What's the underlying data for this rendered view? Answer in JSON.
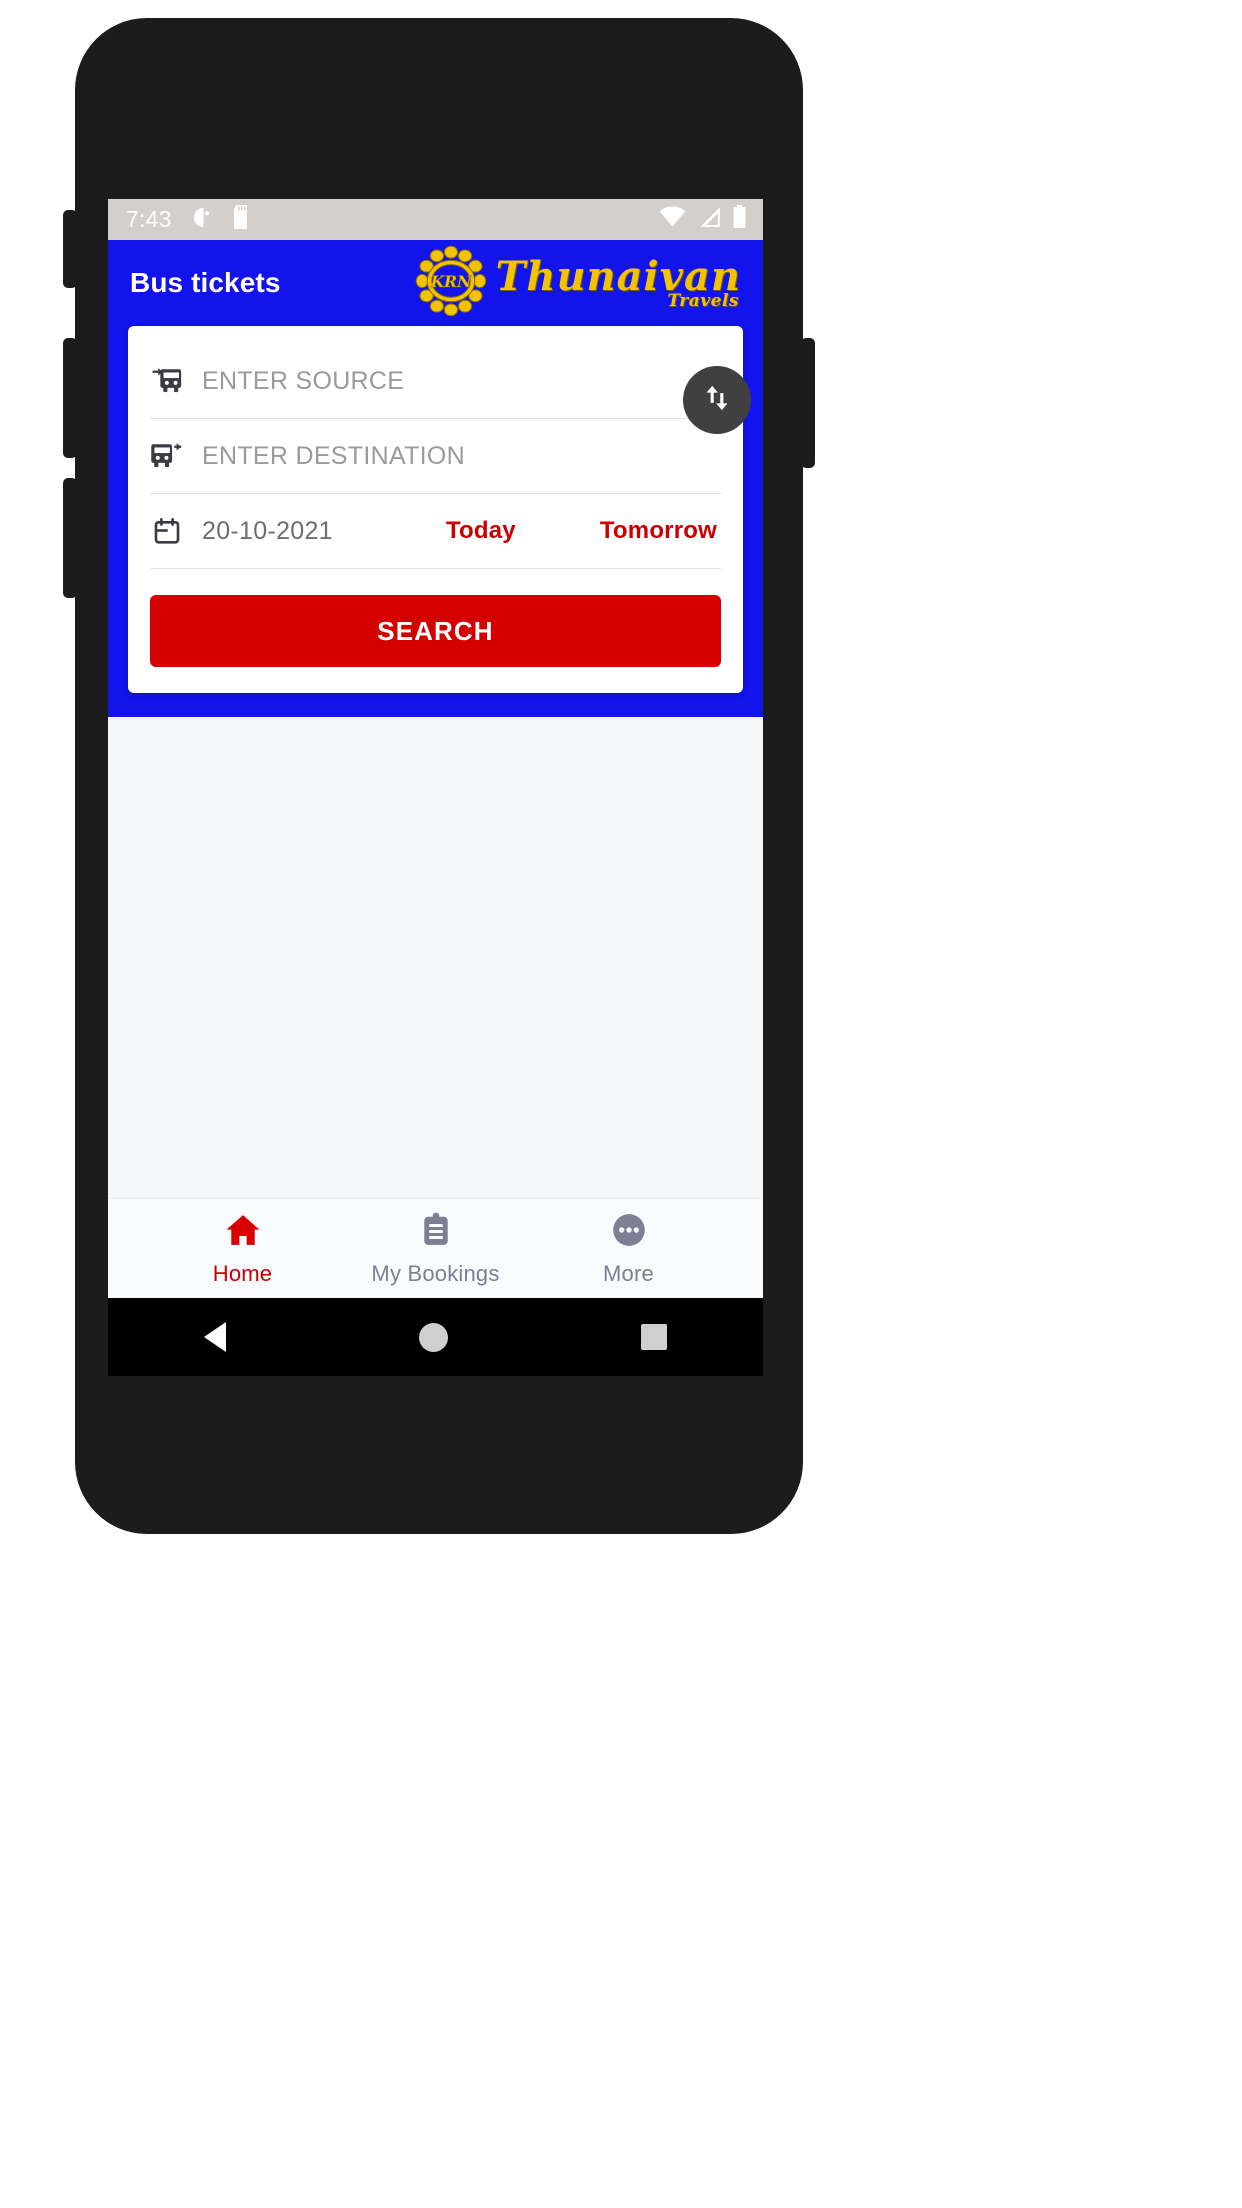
{
  "status_bar": {
    "time": "7:43",
    "left_icons": [
      "do-not-disturb-icon",
      "sd-card-icon"
    ],
    "right_icons": [
      "wifi-icon",
      "cellular-signal-icon",
      "battery-icon"
    ]
  },
  "app_bar": {
    "title": "Bus tickets",
    "brand_name": "Thunaivan",
    "brand_sub": "Travels",
    "logo_text": "KRN",
    "background_color": "#1313EC",
    "title_color": "#FFFFFF",
    "brand_color": "#F2C300"
  },
  "search_card": {
    "source": {
      "icon": "bus-arrive-icon",
      "placeholder": "ENTER SOURCE",
      "value": ""
    },
    "destination": {
      "icon": "bus-depart-icon",
      "placeholder": "ENTER DESTINATION",
      "value": ""
    },
    "date": {
      "icon": "calendar-icon",
      "value": "20-10-2021",
      "today_label": "Today",
      "tomorrow_label": "Tomorrow",
      "quick_color": "#CC0000"
    },
    "swap_button": {
      "icon": "swap-vertical-icon",
      "color": "#404040"
    },
    "search_button": {
      "label": "SEARCH",
      "color": "#D40000",
      "text_color": "#FFFFFF"
    }
  },
  "bottom_nav": {
    "items": [
      {
        "label": "Home",
        "icon": "home-icon",
        "active": true
      },
      {
        "label": "My Bookings",
        "icon": "clipboard-icon",
        "active": false
      },
      {
        "label": "More",
        "icon": "more-dots-icon",
        "active": false
      }
    ],
    "active_color": "#CC0000",
    "inactive_color": "#7F7F93"
  },
  "system_nav": {
    "back": "back-triangle-icon",
    "home": "home-circle-icon",
    "recents": "recents-square-icon"
  }
}
